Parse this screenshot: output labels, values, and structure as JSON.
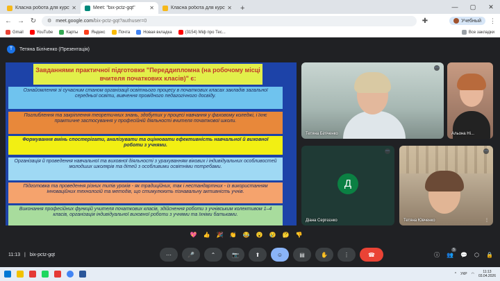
{
  "browser": {
    "tabs": [
      {
        "label": "Класна робота для курсу \"21 Г",
        "active": false,
        "color": "#f6b81a"
      },
      {
        "label": "Meet: \"bix-pctz-gqt\"",
        "active": true,
        "color": "#00897b"
      },
      {
        "label": "Класна робота для курсу \"21 Г",
        "active": false,
        "color": "#f6b81a"
      }
    ],
    "new_tab": "+",
    "window_controls": [
      "—",
      "▢",
      "✕"
    ],
    "address": {
      "url_main": "meet.google.com",
      "url_rest": "/bix-pctz-gqt?authuser=0"
    },
    "profile_label": "Учебный",
    "bookmarks": [
      {
        "label": "Gmail",
        "color": "#ea4335"
      },
      {
        "label": "YouTube",
        "color": "#ff0000"
      },
      {
        "label": "Карты",
        "color": "#34a853"
      },
      {
        "label": "Яндекс",
        "color": "#fc3f1d"
      },
      {
        "label": "Почта",
        "color": "#fbbc04"
      },
      {
        "label": "Новая вкладка",
        "color": "#4285f4"
      },
      {
        "label": "(3154) Мiф про Тес...",
        "color": "#ff0000"
      }
    ],
    "bookmarks_right": "Все закладки"
  },
  "meet": {
    "presenter": {
      "initial": "Т",
      "label": "Тетяна Біліченко (Презентація)"
    },
    "slide": {
      "title": "Завданнями практичної підготовки \"Переддипломна (на робочому місці вчителя початкових класів)\" є:",
      "boxes": [
        {
          "text": "Ознайомлення зі сучасним станом організації освітнього процесу в початкових класах закладів загальної середньої освіти, вивчення провідного педагогічного досвіду.",
          "style": "blue",
          "bold": false
        },
        {
          "text": "Поглиблення та закріплення теоретичних знань, здобутих у процесі навчання у фаховому коледжі, і їхнє практичне застосування у професійній діяльності вчителя початкової школи.",
          "style": "orange",
          "bold": false
        },
        {
          "text": "Формування вмінь спостерігати, аналізувати та оцінювати ефективність навчальної й виховної роботи з учнями.",
          "style": "yellow",
          "bold": true
        },
        {
          "text": "Організація й проведення навчальної та виховної діяльності з урахуванням вікових і індивідуальних особливостей молодших школярів та дітей з особливими освітніми потребами.",
          "style": "cyan",
          "bold": false
        },
        {
          "text": "Підготовка та проведення різних типів уроків - як традиційних, так і нестандартних - із використанням інноваційних технологій та методів, що стимулюють пізнавальну активність учнів.",
          "style": "salmon",
          "bold": false
        },
        {
          "text": "Виконання професійних функцій учителя початкових класів, здійснення роботи з учнівським колективом 1–4 класів, організація індивідуальної виховної роботи з учнями та їхніми батьками.",
          "style": "green",
          "bold": false
        }
      ]
    },
    "participants": [
      {
        "name": "Тетяна Біліченко"
      },
      {
        "name": "Альона Ні..."
      },
      {
        "name": "Діана Сергєєнко",
        "initial": "Д"
      },
      {
        "name": "Тетяна Ювченко"
      }
    ],
    "reactions": [
      "💖",
      "👍",
      "🎉",
      "👏",
      "😂",
      "😮",
      "😢",
      "🤔",
      "👎"
    ],
    "time": "11:13",
    "meeting_code": "bix-pctz-gqt",
    "controls": [
      "⋯",
      "🎤",
      "⌃",
      "📷",
      "⬆",
      "☺",
      "▤",
      "✋",
      "⋮",
      "☎"
    ],
    "people_count": "5"
  },
  "taskbar": {
    "icons": [
      "#0078d4",
      "#f2c200",
      "#e53935",
      "#1ed760",
      "#e53935",
      "#4285f4",
      "#2b579a"
    ],
    "lang": "УКР",
    "time": "11:13",
    "date": "03.04.2026"
  }
}
